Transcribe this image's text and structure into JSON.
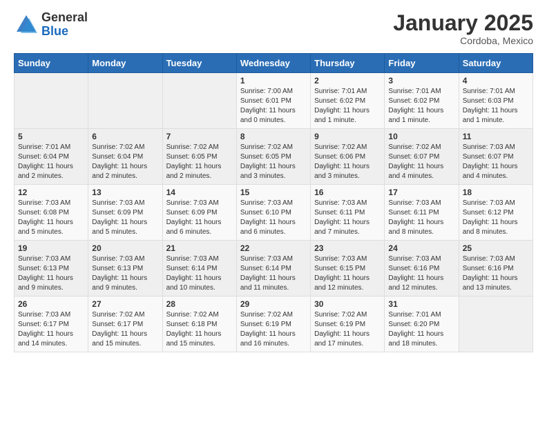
{
  "header": {
    "logo_general": "General",
    "logo_blue": "Blue",
    "month_title": "January 2025",
    "location": "Cordoba, Mexico"
  },
  "days_of_week": [
    "Sunday",
    "Monday",
    "Tuesday",
    "Wednesday",
    "Thursday",
    "Friday",
    "Saturday"
  ],
  "weeks": [
    [
      {
        "day": "",
        "info": ""
      },
      {
        "day": "",
        "info": ""
      },
      {
        "day": "",
        "info": ""
      },
      {
        "day": "1",
        "info": "Sunrise: 7:00 AM\nSunset: 6:01 PM\nDaylight: 11 hours\nand 0 minutes."
      },
      {
        "day": "2",
        "info": "Sunrise: 7:01 AM\nSunset: 6:02 PM\nDaylight: 11 hours\nand 1 minute."
      },
      {
        "day": "3",
        "info": "Sunrise: 7:01 AM\nSunset: 6:02 PM\nDaylight: 11 hours\nand 1 minute."
      },
      {
        "day": "4",
        "info": "Sunrise: 7:01 AM\nSunset: 6:03 PM\nDaylight: 11 hours\nand 1 minute."
      }
    ],
    [
      {
        "day": "5",
        "info": "Sunrise: 7:01 AM\nSunset: 6:04 PM\nDaylight: 11 hours\nand 2 minutes."
      },
      {
        "day": "6",
        "info": "Sunrise: 7:02 AM\nSunset: 6:04 PM\nDaylight: 11 hours\nand 2 minutes."
      },
      {
        "day": "7",
        "info": "Sunrise: 7:02 AM\nSunset: 6:05 PM\nDaylight: 11 hours\nand 2 minutes."
      },
      {
        "day": "8",
        "info": "Sunrise: 7:02 AM\nSunset: 6:05 PM\nDaylight: 11 hours\nand 3 minutes."
      },
      {
        "day": "9",
        "info": "Sunrise: 7:02 AM\nSunset: 6:06 PM\nDaylight: 11 hours\nand 3 minutes."
      },
      {
        "day": "10",
        "info": "Sunrise: 7:02 AM\nSunset: 6:07 PM\nDaylight: 11 hours\nand 4 minutes."
      },
      {
        "day": "11",
        "info": "Sunrise: 7:03 AM\nSunset: 6:07 PM\nDaylight: 11 hours\nand 4 minutes."
      }
    ],
    [
      {
        "day": "12",
        "info": "Sunrise: 7:03 AM\nSunset: 6:08 PM\nDaylight: 11 hours\nand 5 minutes."
      },
      {
        "day": "13",
        "info": "Sunrise: 7:03 AM\nSunset: 6:09 PM\nDaylight: 11 hours\nand 5 minutes."
      },
      {
        "day": "14",
        "info": "Sunrise: 7:03 AM\nSunset: 6:09 PM\nDaylight: 11 hours\nand 6 minutes."
      },
      {
        "day": "15",
        "info": "Sunrise: 7:03 AM\nSunset: 6:10 PM\nDaylight: 11 hours\nand 6 minutes."
      },
      {
        "day": "16",
        "info": "Sunrise: 7:03 AM\nSunset: 6:11 PM\nDaylight: 11 hours\nand 7 minutes."
      },
      {
        "day": "17",
        "info": "Sunrise: 7:03 AM\nSunset: 6:11 PM\nDaylight: 11 hours\nand 8 minutes."
      },
      {
        "day": "18",
        "info": "Sunrise: 7:03 AM\nSunset: 6:12 PM\nDaylight: 11 hours\nand 8 minutes."
      }
    ],
    [
      {
        "day": "19",
        "info": "Sunrise: 7:03 AM\nSunset: 6:13 PM\nDaylight: 11 hours\nand 9 minutes."
      },
      {
        "day": "20",
        "info": "Sunrise: 7:03 AM\nSunset: 6:13 PM\nDaylight: 11 hours\nand 9 minutes."
      },
      {
        "day": "21",
        "info": "Sunrise: 7:03 AM\nSunset: 6:14 PM\nDaylight: 11 hours\nand 10 minutes."
      },
      {
        "day": "22",
        "info": "Sunrise: 7:03 AM\nSunset: 6:14 PM\nDaylight: 11 hours\nand 11 minutes."
      },
      {
        "day": "23",
        "info": "Sunrise: 7:03 AM\nSunset: 6:15 PM\nDaylight: 11 hours\nand 12 minutes."
      },
      {
        "day": "24",
        "info": "Sunrise: 7:03 AM\nSunset: 6:16 PM\nDaylight: 11 hours\nand 12 minutes."
      },
      {
        "day": "25",
        "info": "Sunrise: 7:03 AM\nSunset: 6:16 PM\nDaylight: 11 hours\nand 13 minutes."
      }
    ],
    [
      {
        "day": "26",
        "info": "Sunrise: 7:03 AM\nSunset: 6:17 PM\nDaylight: 11 hours\nand 14 minutes."
      },
      {
        "day": "27",
        "info": "Sunrise: 7:02 AM\nSunset: 6:17 PM\nDaylight: 11 hours\nand 15 minutes."
      },
      {
        "day": "28",
        "info": "Sunrise: 7:02 AM\nSunset: 6:18 PM\nDaylight: 11 hours\nand 15 minutes."
      },
      {
        "day": "29",
        "info": "Sunrise: 7:02 AM\nSunset: 6:19 PM\nDaylight: 11 hours\nand 16 minutes."
      },
      {
        "day": "30",
        "info": "Sunrise: 7:02 AM\nSunset: 6:19 PM\nDaylight: 11 hours\nand 17 minutes."
      },
      {
        "day": "31",
        "info": "Sunrise: 7:01 AM\nSunset: 6:20 PM\nDaylight: 11 hours\nand 18 minutes."
      },
      {
        "day": "",
        "info": ""
      }
    ]
  ]
}
